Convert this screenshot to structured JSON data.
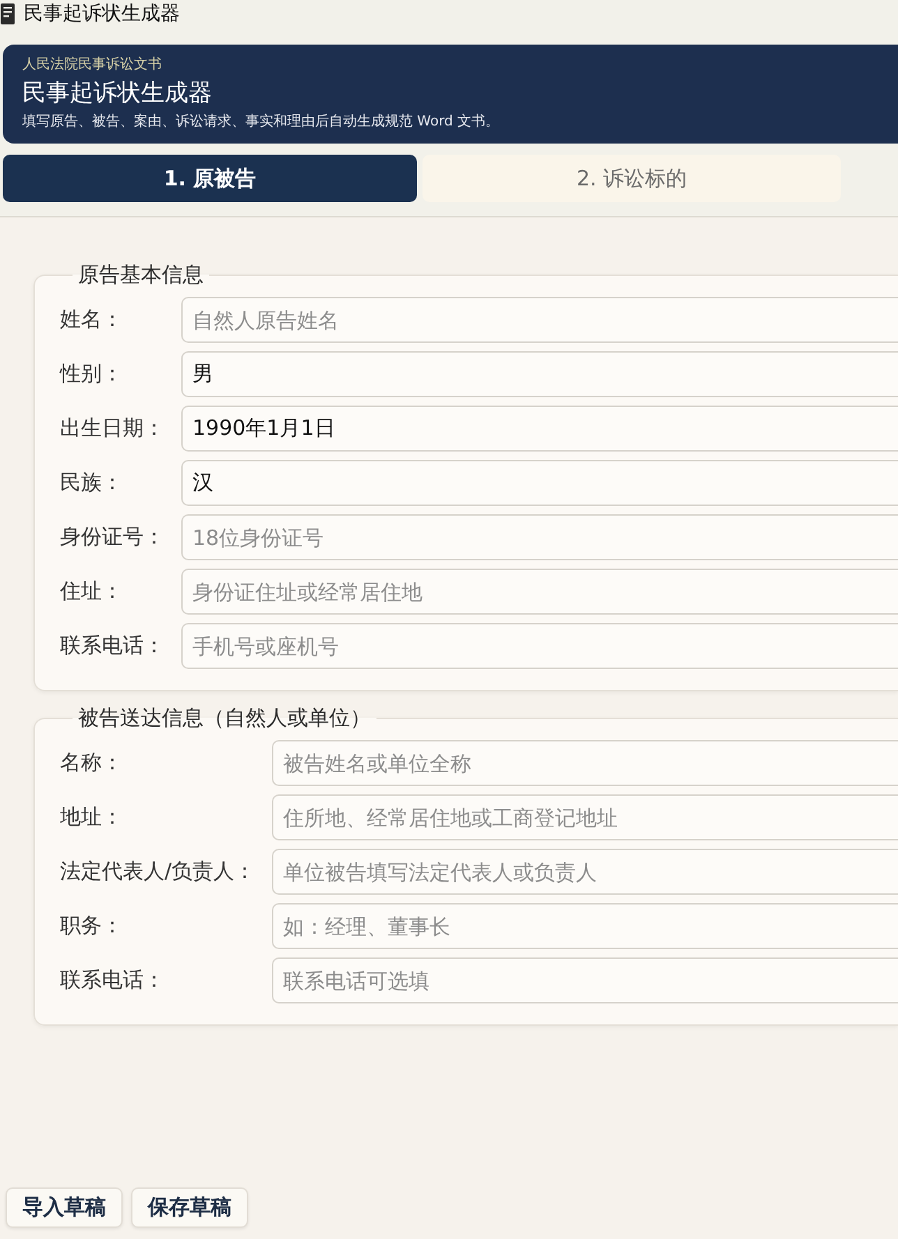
{
  "window": {
    "title": "民事起诉状生成器"
  },
  "header": {
    "subtitle": "人民法院民事诉讼文书",
    "title": "民事起诉状生成器",
    "description": "填写原告、被告、案由、诉讼请求、事实和理由后自动生成规范 Word 文书。"
  },
  "tabs": [
    {
      "label": "1. 原被告",
      "selected": true
    },
    {
      "label": "2. 诉讼标的",
      "selected": false
    }
  ],
  "sections": [
    {
      "title": "原告基本信息",
      "fields": [
        {
          "label": "姓名：",
          "placeholder": "自然人原告姓名"
        },
        {
          "label": "性别：",
          "value": "男"
        },
        {
          "label": "出生日期：",
          "value": "1990年1月1日"
        },
        {
          "label": "民族：",
          "value": "汉"
        },
        {
          "label": "身份证号：",
          "placeholder": "18位身份证号"
        },
        {
          "label": "住址：",
          "placeholder": "身份证住址或经常居住地"
        },
        {
          "label": "联系电话：",
          "placeholder": "手机号或座机号"
        }
      ]
    },
    {
      "title": "被告送达信息（自然人或单位）",
      "fields": [
        {
          "label": "名称：",
          "placeholder": "被告姓名或单位全称"
        },
        {
          "label": "地址：",
          "placeholder": "住所地、经常居住地或工商登记地址"
        },
        {
          "label": "法定代表人/负责人：",
          "placeholder": "单位被告填写法定代表人或负责人"
        },
        {
          "label": "职务：",
          "placeholder": "如：经理、董事长"
        },
        {
          "label": "联系电话：",
          "placeholder": "联系电话可选填"
        }
      ]
    }
  ],
  "buttons": [
    "导入草稿",
    "保存草稿"
  ]
}
